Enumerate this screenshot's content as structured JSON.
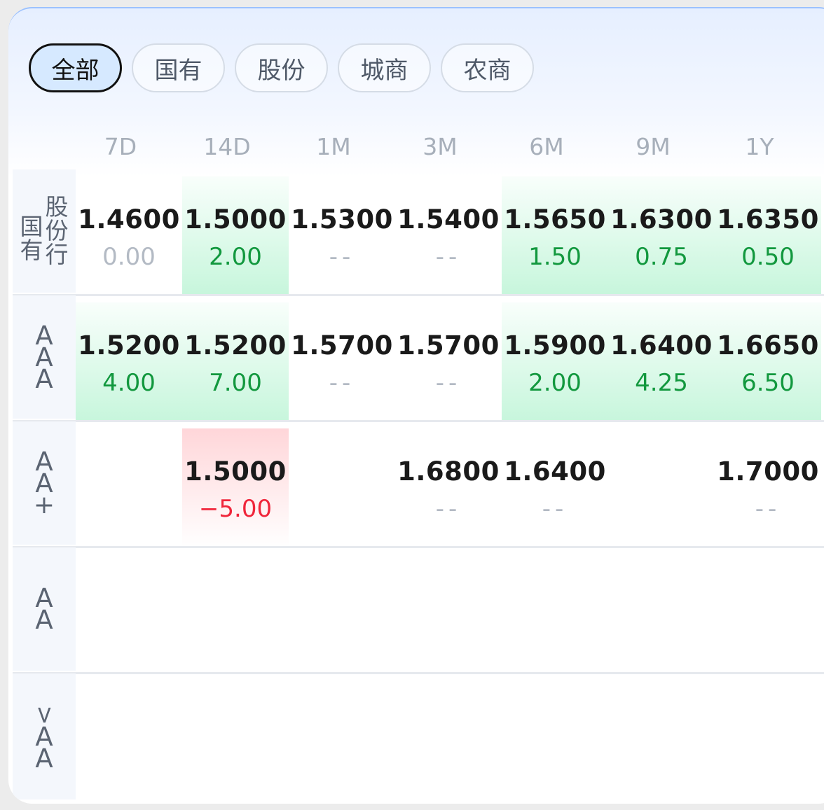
{
  "filters": [
    {
      "label": "全部",
      "active": true
    },
    {
      "label": "国有",
      "active": false
    },
    {
      "label": "股份",
      "active": false
    },
    {
      "label": "城商",
      "active": false
    },
    {
      "label": "农商",
      "active": false
    }
  ],
  "columns": [
    "7D",
    "14D",
    "1M",
    "3M",
    "6M",
    "9M",
    "1Y"
  ],
  "rows": [
    {
      "label_lines": [
        "国有"
      ],
      "label_lines2": [
        "股份行"
      ],
      "cells": [
        {
          "rate": "1.4600",
          "change": "0.00",
          "trend": "zero"
        },
        {
          "rate": "1.5000",
          "change": "2.00",
          "trend": "up"
        },
        {
          "rate": "1.5300",
          "change": "--",
          "trend": "none"
        },
        {
          "rate": "1.5400",
          "change": "--",
          "trend": "none"
        },
        {
          "rate": "1.5650",
          "change": "1.50",
          "trend": "up"
        },
        {
          "rate": "1.6300",
          "change": "0.75",
          "trend": "up"
        },
        {
          "rate": "1.6350",
          "change": "0.50",
          "trend": "up"
        }
      ]
    },
    {
      "label": "AAA",
      "cells": [
        {
          "rate": "1.5200",
          "change": "4.00",
          "trend": "up"
        },
        {
          "rate": "1.5200",
          "change": "7.00",
          "trend": "up"
        },
        {
          "rate": "1.5700",
          "change": "--",
          "trend": "none"
        },
        {
          "rate": "1.5700",
          "change": "--",
          "trend": "none"
        },
        {
          "rate": "1.5900",
          "change": "2.00",
          "trend": "up"
        },
        {
          "rate": "1.6400",
          "change": "4.25",
          "trend": "up"
        },
        {
          "rate": "1.6650",
          "change": "6.50",
          "trend": "up"
        }
      ]
    },
    {
      "label": "AA+",
      "cells": [
        null,
        {
          "rate": "1.5000",
          "change": "-5.00",
          "trend": "down"
        },
        null,
        {
          "rate": "1.6800",
          "change": "--",
          "trend": "none"
        },
        {
          "rate": "1.6400",
          "change": "--",
          "trend": "none"
        },
        null,
        {
          "rate": "1.7000",
          "change": "--",
          "trend": "none"
        }
      ]
    },
    {
      "label": "AA",
      "cells": [
        null,
        null,
        null,
        null,
        null,
        null,
        null
      ]
    },
    {
      "label": "<AA",
      "cells": [
        null,
        null,
        null,
        null,
        null,
        null,
        null
      ]
    }
  ]
}
